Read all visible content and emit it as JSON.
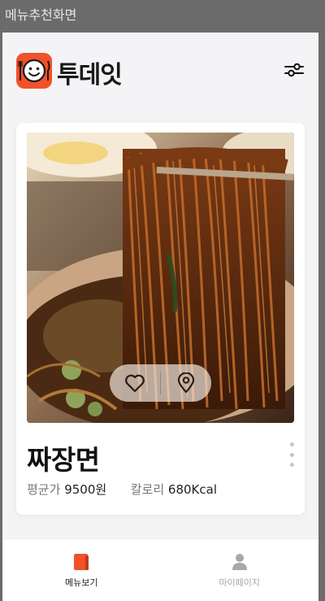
{
  "window": {
    "title": "메뉴추천화면"
  },
  "header": {
    "brand": "투데잇",
    "logo_icon": "smiling-face-with-fork-knife-icon",
    "filter_icon": "sliders-icon"
  },
  "card": {
    "image": "jajangmyeon-noodles-lifted-by-chopsticks",
    "dish_name": "짜장면",
    "price_label": "평균가",
    "price_value": "9500원",
    "calorie_label": "칼로리",
    "calorie_value": "680Kcal",
    "like_icon": "heart-icon",
    "location_icon": "map-pin-icon",
    "more_icon": "vertical-dots-icon"
  },
  "nav": {
    "items": [
      {
        "label": "메뉴보기",
        "icon": "book-icon",
        "active": true
      },
      {
        "label": "마이페이지",
        "icon": "person-icon",
        "active": false
      }
    ]
  },
  "colors": {
    "accent": "#f2512a",
    "background": "#f4f4f6",
    "card": "#ffffff",
    "inactive": "#a8a8a8"
  }
}
